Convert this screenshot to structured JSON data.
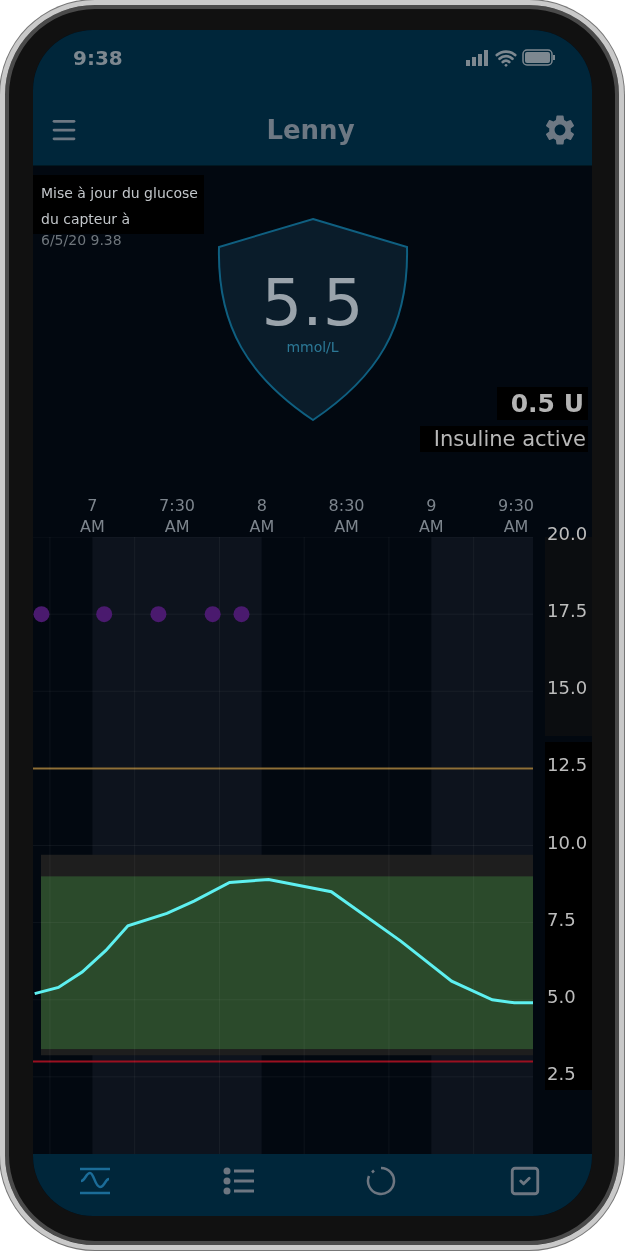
{
  "status_bar": {
    "time": "9:38"
  },
  "header": {
    "title": "Lenny"
  },
  "sensor_update": {
    "text": "Mise à jour du glucose du capteur à",
    "timestamp": "6/5/20 9.38"
  },
  "glucose": {
    "value": "5.5",
    "unit": "mmol/L"
  },
  "insulin": {
    "amount": "0.5 U",
    "label": "Insuline active"
  },
  "chart": {
    "chart_data": {
      "type": "line",
      "xlim": [
        6.65,
        9.6
      ],
      "ylim": [
        0,
        20
      ],
      "xticks": [
        {
          "value": 7,
          "label": "7 AM"
        },
        {
          "value": 7.5,
          "label": "7:30 AM"
        },
        {
          "value": 8,
          "label": "8 AM"
        },
        {
          "value": 8.5,
          "label": "8:30 AM"
        },
        {
          "value": 9,
          "label": "9 AM"
        },
        {
          "value": 9.5,
          "label": "9:30 AM"
        }
      ],
      "yticks": [
        {
          "value": 20,
          "label": "20.0"
        },
        {
          "value": 17.5,
          "label": "17.5"
        },
        {
          "value": 15,
          "label": "15.0"
        },
        {
          "value": 12.5,
          "label": "12.5"
        },
        {
          "value": 10,
          "label": "10.0"
        },
        {
          "value": 7.5,
          "label": "7.5"
        },
        {
          "value": 5,
          "label": "5.0"
        },
        {
          "value": 2.5,
          "label": "2.5"
        }
      ],
      "series": [
        {
          "type": "line",
          "color": "#5ef0f0",
          "x": [
            6.66,
            6.8,
            6.94,
            7.08,
            7.21,
            7.44,
            7.6,
            7.81,
            8.04,
            8.41,
            8.82,
            9.12,
            9.36,
            9.49,
            9.6
          ],
          "values": [
            5.2,
            5.4,
            5.9,
            6.6,
            7.4,
            7.8,
            8.2,
            8.8,
            8.9,
            8.5,
            6.9,
            5.6,
            5.0,
            4.9,
            4.9
          ]
        },
        {
          "type": "scatter",
          "color": "#4a1a6e",
          "x": [
            6.7,
            7.07,
            7.39,
            7.71,
            7.88
          ],
          "values": [
            17.5,
            17.5,
            17.5,
            17.5,
            17.5
          ]
        }
      ],
      "grid": true,
      "bands": [
        {
          "axis": "y",
          "from": 3.2,
          "to": 9.7,
          "color": "#1e1e1e"
        },
        {
          "axis": "y",
          "from": 3.4,
          "to": 9.0,
          "color": "#2b4a2b"
        }
      ],
      "ref_lines": [
        {
          "axis": "y",
          "value": 12.5,
          "color": "#8a6a30"
        },
        {
          "axis": "y",
          "value": 3.0,
          "color": "#9a1020"
        }
      ]
    }
  },
  "nav": [
    {
      "kind": "trend",
      "selected": true
    },
    {
      "kind": "list",
      "selected": false
    },
    {
      "kind": "sync",
      "selected": false
    },
    {
      "kind": "tasks",
      "selected": false
    }
  ]
}
